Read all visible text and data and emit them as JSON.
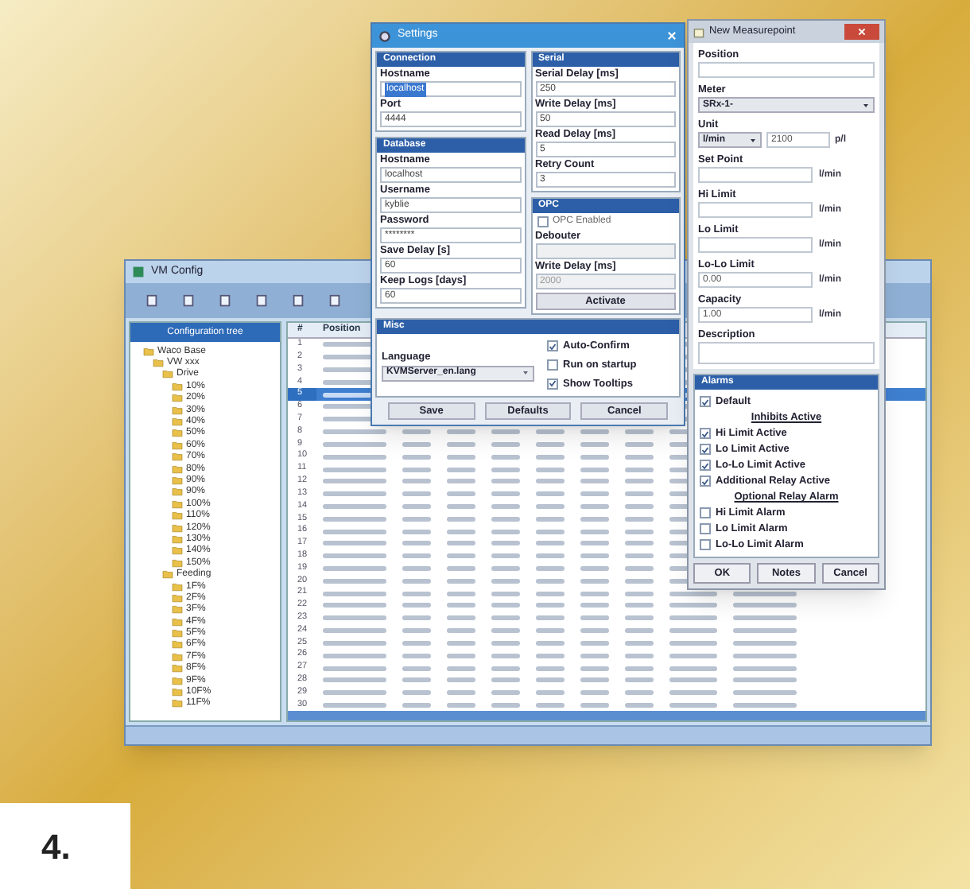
{
  "badge": "4.",
  "vm_window": {
    "title": "VM Config",
    "tree_header": "Configuration tree",
    "tree": [
      {
        "label": "Waco Base",
        "children": [
          {
            "label": "VW xxx",
            "children": [
              {
                "label": "Drive",
                "children": [
                  {
                    "label": "10%"
                  },
                  {
                    "label": "20%"
                  },
                  {
                    "label": "30%"
                  },
                  {
                    "label": "40%"
                  },
                  {
                    "label": "50%"
                  },
                  {
                    "label": "60%"
                  },
                  {
                    "label": "70%"
                  },
                  {
                    "label": "80%"
                  },
                  {
                    "label": "90%"
                  },
                  {
                    "label": "90%"
                  },
                  {
                    "label": "100%"
                  },
                  {
                    "label": "110%"
                  },
                  {
                    "label": "120%"
                  },
                  {
                    "label": "130%"
                  },
                  {
                    "label": "140%"
                  },
                  {
                    "label": "150%"
                  }
                ]
              },
              {
                "label": "Feeding",
                "children": [
                  {
                    "label": "1F%"
                  },
                  {
                    "label": "2F%"
                  },
                  {
                    "label": "3F%"
                  },
                  {
                    "label": "4F%"
                  },
                  {
                    "label": "5F%"
                  },
                  {
                    "label": "6F%"
                  },
                  {
                    "label": "7F%"
                  },
                  {
                    "label": "8F%"
                  },
                  {
                    "label": "9F%"
                  },
                  {
                    "label": "10F%"
                  },
                  {
                    "label": "11F%"
                  }
                ]
              }
            ]
          }
        ]
      }
    ],
    "table": {
      "columns": [
        "#",
        "Position"
      ],
      "rows": [
        {
          "number": "1",
          "selected": false
        },
        {
          "number": "2",
          "selected": false
        },
        {
          "number": "3",
          "selected": false
        },
        {
          "number": "4",
          "selected": false
        },
        {
          "number": "5",
          "selected": true
        },
        {
          "number": "6",
          "selected": false
        },
        {
          "number": "7",
          "selected": false
        },
        {
          "number": "8",
          "selected": false
        },
        {
          "number": "9",
          "selected": false
        },
        {
          "number": "10",
          "selected": false
        },
        {
          "number": "11",
          "selected": false
        },
        {
          "number": "12",
          "selected": false
        },
        {
          "number": "13",
          "selected": false
        },
        {
          "number": "14",
          "selected": false
        },
        {
          "number": "15",
          "selected": false
        },
        {
          "number": "16",
          "selected": false
        },
        {
          "number": "17",
          "selected": false
        },
        {
          "number": "18",
          "selected": false
        },
        {
          "number": "19",
          "selected": false
        },
        {
          "number": "20",
          "selected": false
        },
        {
          "number": "21",
          "selected": false
        },
        {
          "number": "22",
          "selected": false
        },
        {
          "number": "23",
          "selected": false
        },
        {
          "number": "24",
          "selected": false
        },
        {
          "number": "25",
          "selected": false
        },
        {
          "number": "26",
          "selected": false
        },
        {
          "number": "27",
          "selected": false
        },
        {
          "number": "28",
          "selected": false
        },
        {
          "number": "29",
          "selected": false
        },
        {
          "number": "30",
          "selected": false
        }
      ]
    }
  },
  "settings": {
    "title": "Settings",
    "left": [
      {
        "heading": "Connection",
        "fields": [
          {
            "label": "Hostname",
            "value": "localhost",
            "highlighted": true,
            "disabled": false
          },
          {
            "label": "Port",
            "value": "4444",
            "highlighted": false,
            "disabled": false
          }
        ]
      },
      {
        "heading": "Database",
        "fields": [
          {
            "label": "Hostname",
            "value": "localhost",
            "highlighted": false,
            "disabled": false
          },
          {
            "label": "Username",
            "value": "kyblie",
            "highlighted": false,
            "disabled": false
          },
          {
            "label": "Password",
            "value": "********",
            "highlighted": false,
            "disabled": false
          },
          {
            "label": "Save Delay [s]",
            "value": "60",
            "highlighted": false,
            "disabled": false
          },
          {
            "label": "Keep Logs [days]",
            "value": "60",
            "highlighted": false,
            "disabled": false
          }
        ]
      }
    ],
    "right": [
      {
        "heading": "Serial",
        "fields": [
          {
            "label": "Serial Delay [ms]",
            "value": "250",
            "highlighted": false,
            "disabled": false
          },
          {
            "label": "Write Delay [ms]",
            "value": "50",
            "highlighted": false,
            "disabled": false
          },
          {
            "label": "Read Delay [ms]",
            "value": "5",
            "highlighted": false,
            "disabled": false
          },
          {
            "label": "Retry Count",
            "value": "3",
            "highlighted": false,
            "disabled": false
          }
        ]
      }
    ],
    "opc": {
      "heading": "OPC",
      "enabled_label": "OPC Enabled",
      "checked": false,
      "fields": [
        {
          "label": "Debouter",
          "highlighted": false,
          "disabled": true
        },
        {
          "label": "Write Delay [ms]",
          "value": "2000",
          "highlighted": false,
          "disabled": true
        }
      ],
      "button": "Activate"
    },
    "misc": {
      "heading": "Misc",
      "language_label": "Language",
      "language": "KVMServer_en.lang",
      "options": [
        {
          "label": "Auto-Confirm",
          "checked": true
        },
        {
          "label": "Run on startup",
          "checked": false
        },
        {
          "label": "Show Tooltips",
          "checked": true
        }
      ]
    },
    "buttons": [
      "Save",
      "Defaults",
      "Cancel"
    ]
  },
  "measurepoint": {
    "title": "New Measurepoint",
    "position_label": "Position",
    "meter_label": "Meter",
    "meter": "SRx-1-",
    "unit_label": "Unit",
    "unit": "l/min",
    "unit_value": "2100",
    "unit_suffix": "p/l",
    "limits": [
      {
        "label": "Set Point",
        "unit": "l/min"
      },
      {
        "label": "Hi Limit",
        "unit": "l/min"
      },
      {
        "label": "Lo Limit",
        "unit": "l/min"
      },
      {
        "label": "Lo-Lo Limit",
        "value": "0.00",
        "unit": "l/min"
      },
      {
        "label": "Capacity",
        "value": "1.00",
        "unit": "l/min"
      }
    ],
    "description_label": "Description",
    "alarms": {
      "heading": "Alarms",
      "items": [
        {
          "kind": "check",
          "label": "Default",
          "checked": true
        },
        {
          "kind": "heading",
          "label": "Inhibits Active"
        },
        {
          "kind": "check",
          "label": "Hi Limit Active",
          "checked": true
        },
        {
          "kind": "check",
          "label": "Lo Limit Active",
          "checked": true
        },
        {
          "kind": "check",
          "label": "Lo-Lo Limit Active",
          "checked": true
        },
        {
          "kind": "check",
          "label": "Additional Relay Active",
          "checked": true
        },
        {
          "kind": "heading",
          "label": "Optional Relay Alarm"
        },
        {
          "kind": "check",
          "label": "Hi Limit Alarm",
          "checked": false
        },
        {
          "kind": "check",
          "label": "Lo Limit Alarm",
          "checked": false
        },
        {
          "kind": "check",
          "label": "Lo-Lo Limit Alarm",
          "checked": false
        }
      ]
    },
    "buttons": [
      "OK",
      "Notes",
      "Cancel"
    ]
  }
}
